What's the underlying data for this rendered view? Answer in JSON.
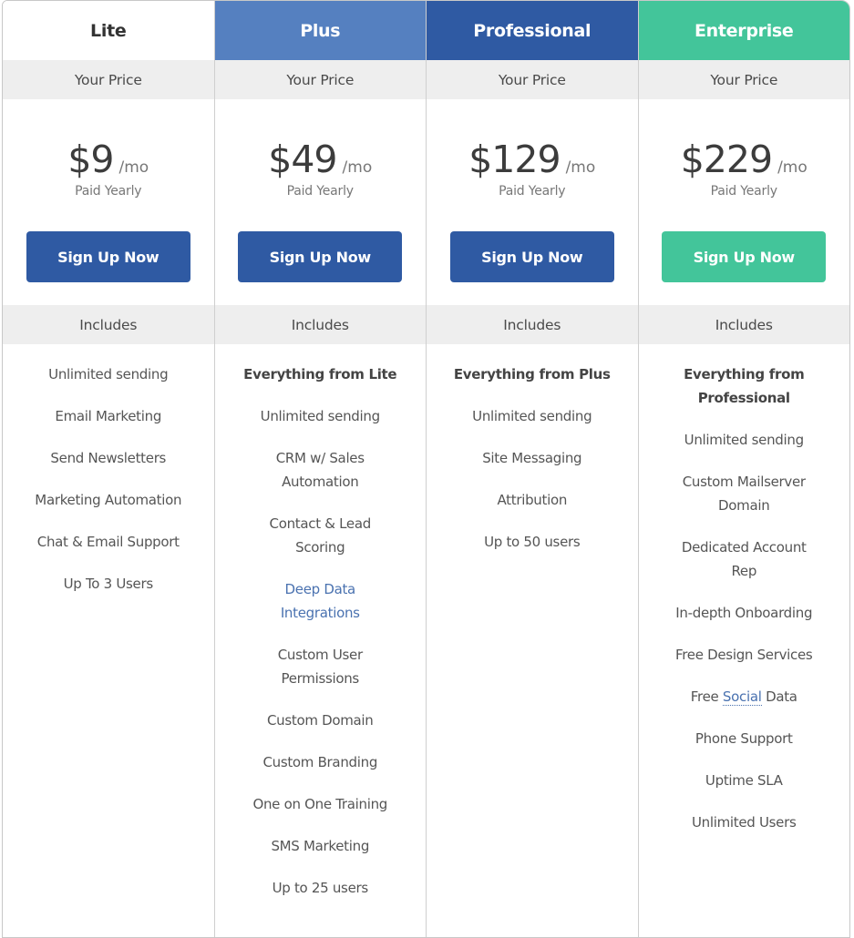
{
  "common": {
    "your_price": "Your Price",
    "paid_yearly": "Paid Yearly",
    "per_month": "/mo",
    "signup": "Sign Up Now",
    "includes": "Includes"
  },
  "colors": {
    "plus_header": "#5580c0",
    "professional_header": "#2f5aa3",
    "enterprise_header": "#43c59a",
    "button_blue": "#2f5aa3",
    "button_green": "#43c59a",
    "link_blue": "#4a72b0"
  },
  "plans": [
    {
      "name": "Lite",
      "price": "$9",
      "features": [
        "Unlimited sending",
        "Email Marketing",
        "Send Newsletters",
        "Marketing Automation",
        "Chat & Email Support",
        "Up To 3 Users"
      ]
    },
    {
      "name": "Plus",
      "price": "$49",
      "features": [
        "Everything from Lite",
        "Unlimited sending",
        "CRM w/ Sales Automation",
        "Contact & Lead Scoring",
        "Deep Data Integrations",
        "Custom User Permissions",
        "Custom Domain",
        "Custom Branding",
        "One on One Training",
        "SMS Marketing",
        "Up to 25 users"
      ]
    },
    {
      "name": "Professional",
      "price": "$129",
      "features": [
        "Everything from Plus",
        "Unlimited sending",
        "Site Messaging",
        "Attribution",
        "Up to 50 users"
      ]
    },
    {
      "name": "Enterprise",
      "price": "$229",
      "features": [
        "Everything from Professional",
        "Unlimited sending",
        "Custom Mailserver Domain",
        "Dedicated Account Rep",
        "In-depth Onboarding",
        "Free Design Services",
        "Free",
        "Social",
        "Data",
        "Phone Support",
        "Uptime SLA",
        "Unlimited Users"
      ]
    }
  ]
}
